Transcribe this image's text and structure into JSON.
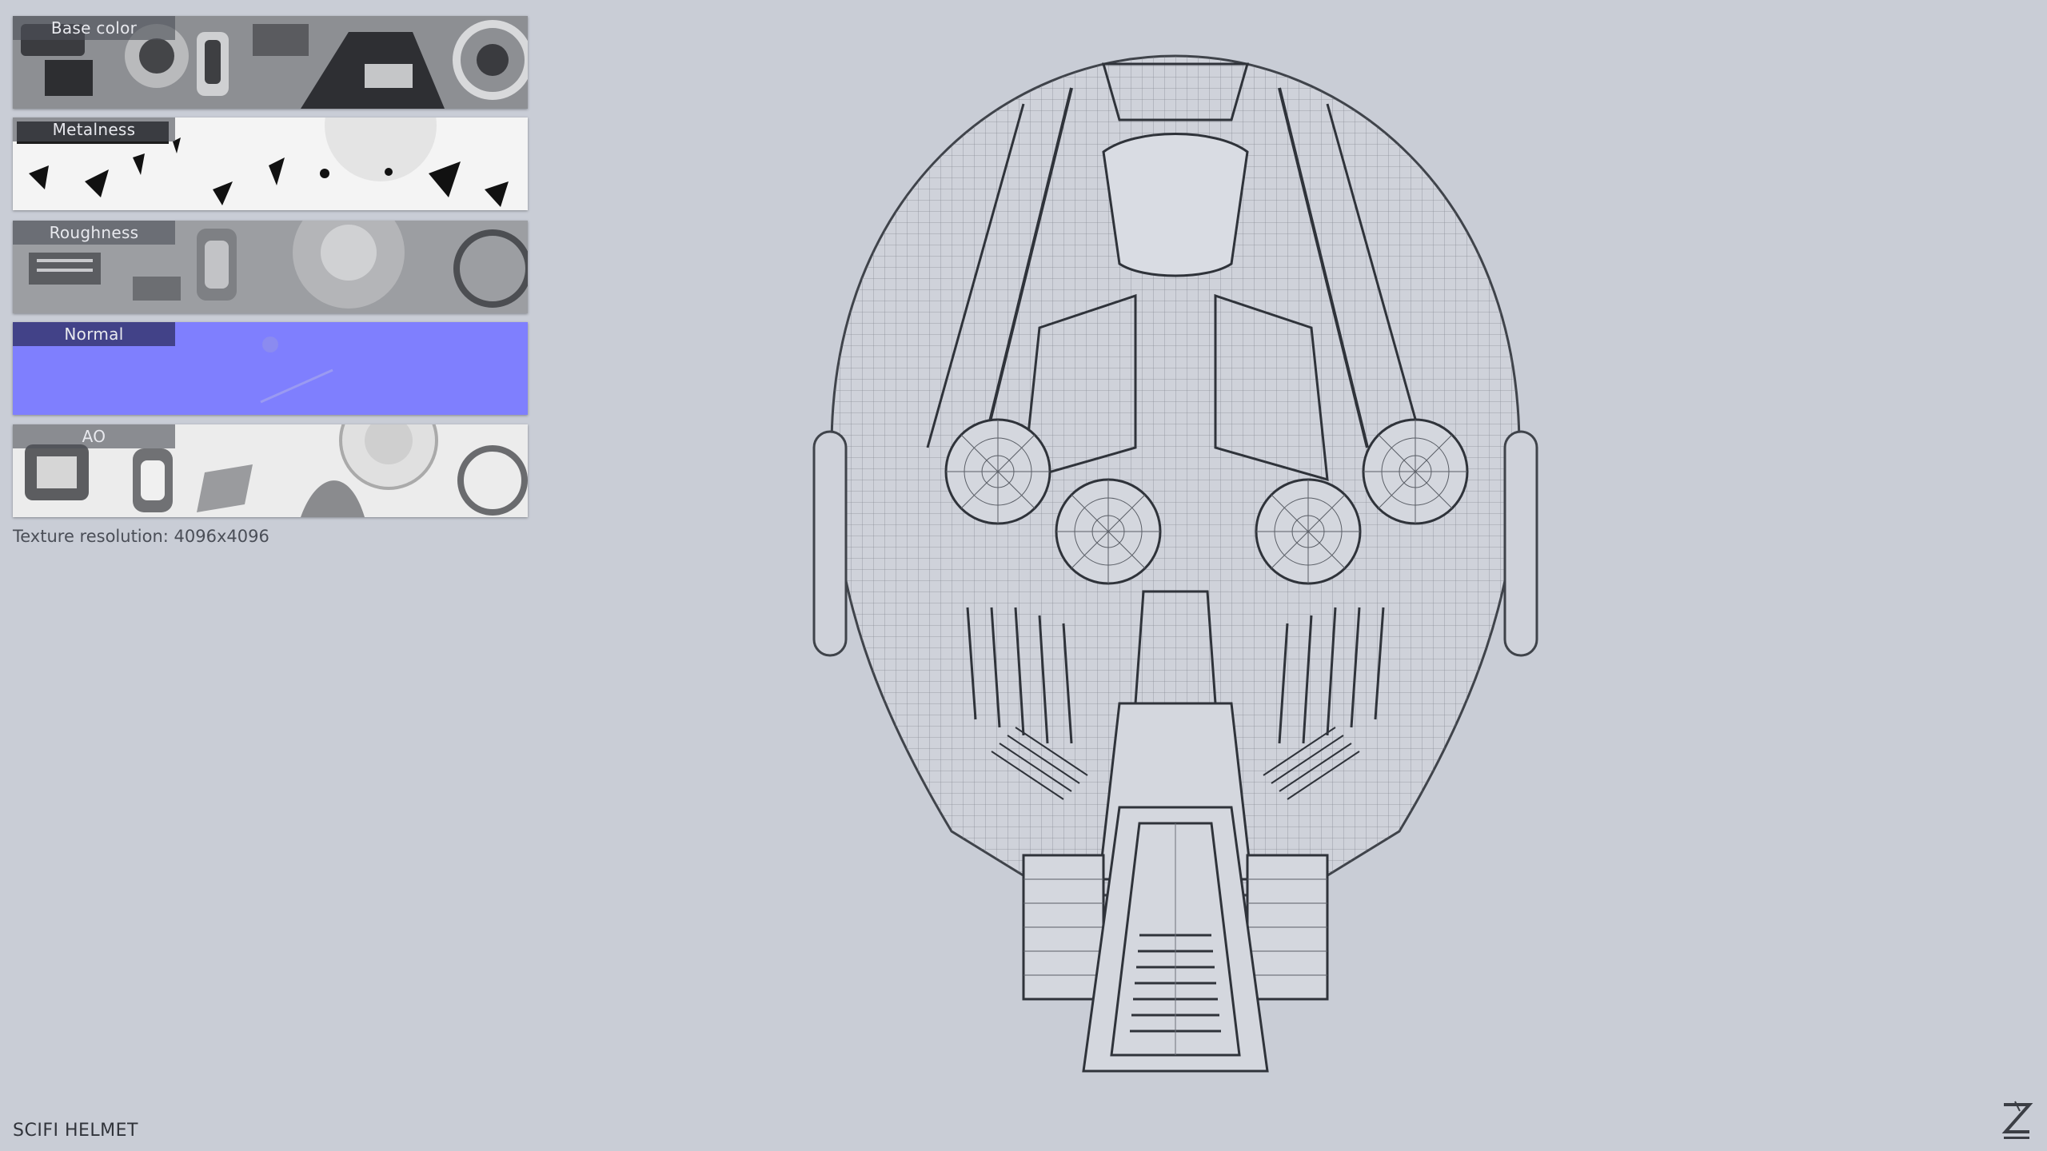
{
  "maps": [
    {
      "label": "Base color"
    },
    {
      "label": "Metalness"
    },
    {
      "label": "Roughness"
    },
    {
      "label": "Normal"
    },
    {
      "label": "AO"
    }
  ],
  "resolution_text": "Texture resolution: 4096x4096",
  "model_title": "SCIFI HELMET",
  "colors": {
    "background": "#c9cdd6",
    "normal_map": "#7f7ffe",
    "wire": "#4a4e56"
  },
  "icons": {
    "logo": "z-logo-icon"
  }
}
